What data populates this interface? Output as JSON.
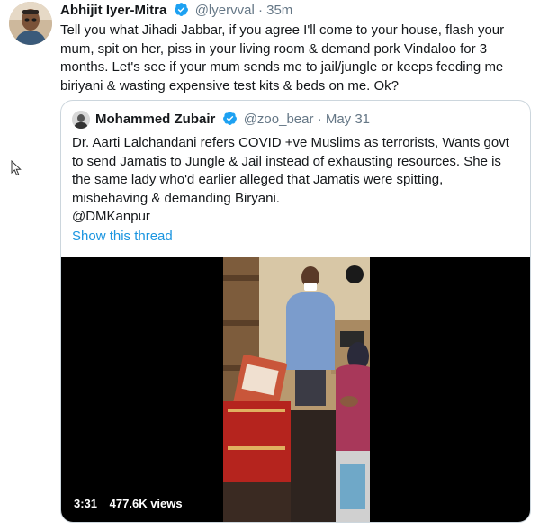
{
  "tweet": {
    "author_name": "Abhijit Iyer-Mitra",
    "handle": "@lyervval",
    "separator": "·",
    "time": "35m",
    "text": "Tell you what Jihadi Jabbar, if you agree I'll come to your house, flash your mum, spit on her, piss in your living room & demand pork Vindaloo for 3 months. Let's see if your mum sends me to jail/jungle or keeps feeding me biriyani & wasting expensive test kits & beds on me. Ok?"
  },
  "quoted_tweet": {
    "author_name": "Mohammed Zubair",
    "handle": "@zoo_bear",
    "separator": "·",
    "time": "May 31",
    "text_lines": [
      "Dr. Aarti Lalchandani refers COVID +ve Muslims as terrorists, Wants govt",
      "to send Jamatis to Jungle & Jail instead of exhausting resources. She is",
      "the same lady who'd earlier alleged that Jamatis were spitting,",
      "misbehaving & demanding Biryani.",
      "@DMKanpur"
    ],
    "show_thread_label": "Show this thread",
    "video": {
      "duration": "3:31",
      "views": "477.6K views"
    }
  },
  "colors": {
    "link": "#1b95e0",
    "secondary_text": "#657786",
    "verified_badge": "#1da1f2",
    "border": "#ccd6dd"
  },
  "icons": {
    "verified": "verified-badge-icon",
    "cursor": "mouse-pointer-icon"
  }
}
